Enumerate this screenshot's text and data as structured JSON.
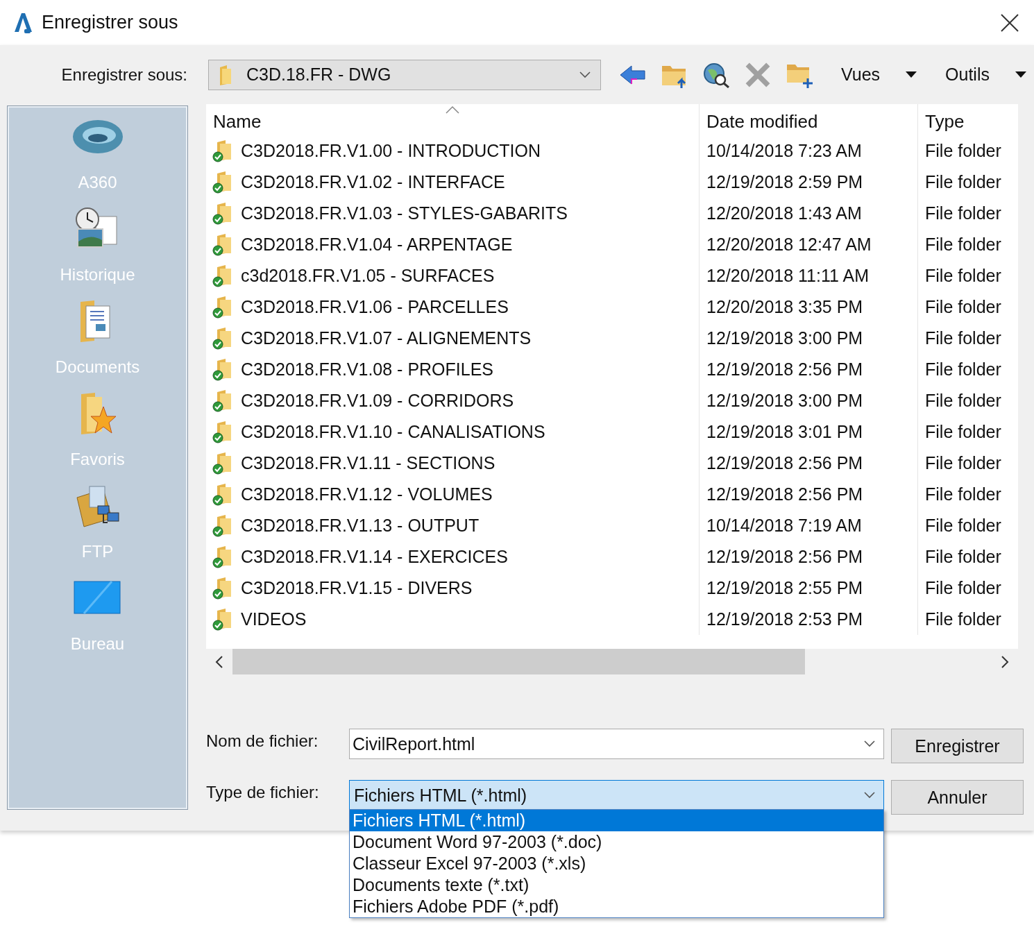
{
  "window": {
    "title": "Enregistrer sous"
  },
  "location": {
    "label": "Enregistrer sous:",
    "value": "C3D.18.FR - DWG"
  },
  "toolbar": {
    "menus": [
      {
        "label": "Vues"
      },
      {
        "label": "Outils"
      }
    ]
  },
  "places": [
    {
      "label": "A360",
      "kind": "cloud"
    },
    {
      "label": "Historique",
      "kind": "history"
    },
    {
      "label": "Documents",
      "kind": "documents"
    },
    {
      "label": "Favoris",
      "kind": "favorites"
    },
    {
      "label": "FTP",
      "kind": "ftp"
    },
    {
      "label": "Bureau",
      "kind": "desktop"
    }
  ],
  "table": {
    "columns": [
      "Name",
      "Date modified",
      "Type"
    ],
    "rows": [
      {
        "name": "C3D2018.FR.V1.00 - INTRODUCTION",
        "date": "10/14/2018 7:23 AM",
        "type": "File folder"
      },
      {
        "name": "C3D2018.FR.V1.02 - INTERFACE",
        "date": "12/19/2018 2:59 PM",
        "type": "File folder"
      },
      {
        "name": "C3D2018.FR.V1.03 - STYLES-GABARITS",
        "date": "12/20/2018 1:43 AM",
        "type": "File folder"
      },
      {
        "name": "C3D2018.FR.V1.04 - ARPENTAGE",
        "date": "12/20/2018 12:47 AM",
        "type": "File folder"
      },
      {
        "name": "c3d2018.FR.V1.05 - SURFACES",
        "date": "12/20/2018 11:11 AM",
        "type": "File folder"
      },
      {
        "name": "C3D2018.FR.V1.06 - PARCELLES",
        "date": "12/20/2018 3:35 PM",
        "type": "File folder"
      },
      {
        "name": "C3D2018.FR.V1.07 - ALIGNEMENTS",
        "date": "12/19/2018 3:00 PM",
        "type": "File folder"
      },
      {
        "name": "C3D2018.FR.V1.08 - PROFILES",
        "date": "12/19/2018 2:56 PM",
        "type": "File folder"
      },
      {
        "name": "C3D2018.FR.V1.09 - CORRIDORS",
        "date": "12/19/2018 3:00 PM",
        "type": "File folder"
      },
      {
        "name": "C3D2018.FR.V1.10 - CANALISATIONS",
        "date": "12/19/2018 3:01 PM",
        "type": "File folder"
      },
      {
        "name": "C3D2018.FR.V1.11 - SECTIONS",
        "date": "12/19/2018 2:56 PM",
        "type": "File folder"
      },
      {
        "name": "C3D2018.FR.V1.12 - VOLUMES",
        "date": "12/19/2018 2:56 PM",
        "type": "File folder"
      },
      {
        "name": "C3D2018.FR.V1.13 - OUTPUT",
        "date": "10/14/2018 7:19 AM",
        "type": "File folder"
      },
      {
        "name": "C3D2018.FR.V1.14 - EXERCICES",
        "date": "12/19/2018 2:56 PM",
        "type": "File folder"
      },
      {
        "name": "C3D2018.FR.V1.15 - DIVERS",
        "date": "12/19/2018 2:55 PM",
        "type": "File folder"
      },
      {
        "name": "VIDEOS",
        "date": "12/19/2018 2:53 PM",
        "type": "File folder"
      }
    ]
  },
  "filename": {
    "label": "Nom de fichier:",
    "value": "CivilReport.html"
  },
  "filetype": {
    "label": "Type de fichier:",
    "value": "Fichiers HTML (*.html)",
    "options": [
      {
        "label": "Fichiers HTML (*.html)",
        "selected": true
      },
      {
        "label": "Document Word 97-2003 (*.doc)",
        "selected": false
      },
      {
        "label": "Classeur Excel 97-2003 (*.xls)",
        "selected": false
      },
      {
        "label": "Documents texte (*.txt)",
        "selected": false
      },
      {
        "label": "Fichiers Adobe PDF (*.pdf)",
        "selected": false
      }
    ]
  },
  "buttons": [
    "Enregistrer",
    "Annuler"
  ]
}
